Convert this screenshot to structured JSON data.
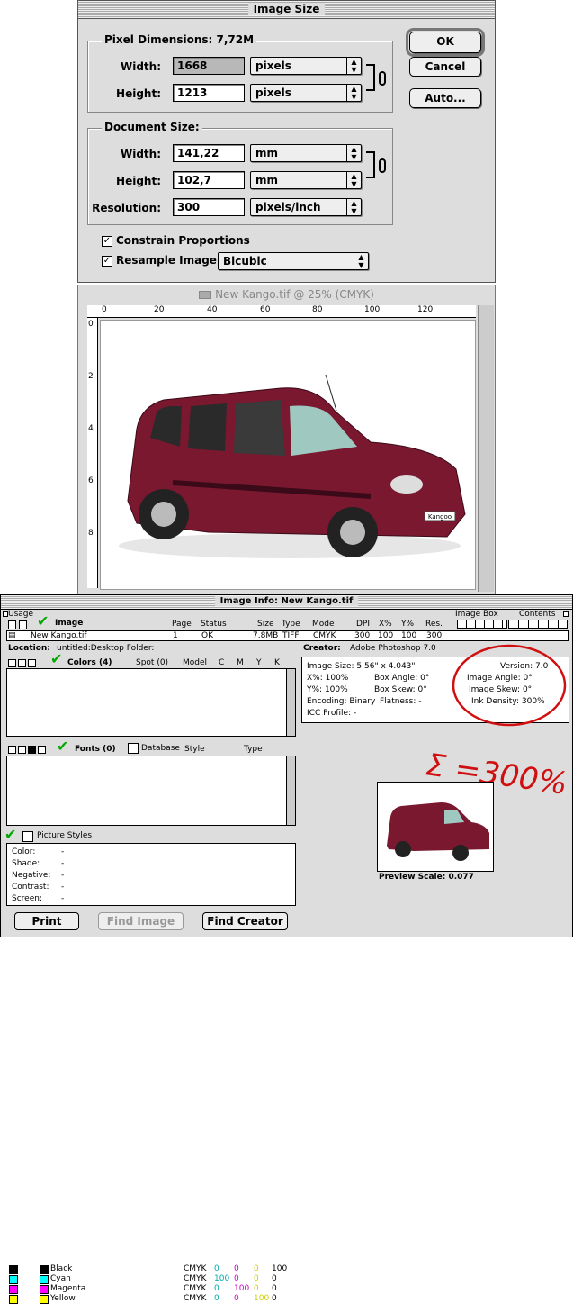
{
  "dialog": {
    "title": "Image Size",
    "pixel_dimensions_label": "Pixel Dimensions: 7,72M",
    "width_label": "Width:",
    "width_value": "1668",
    "width_unit": "pixels",
    "height_label": "Height:",
    "height_value": "1213",
    "height_unit": "pixels",
    "document_size_label": "Document Size:",
    "doc_width_label": "Width:",
    "doc_width_value": "141,22",
    "doc_width_unit": "mm",
    "doc_height_label": "Height:",
    "doc_height_value": "102,7",
    "doc_height_unit": "mm",
    "resolution_label": "Resolution:",
    "resolution_value": "300",
    "resolution_unit": "pixels/inch",
    "constrain_label": "Constrain Proportions",
    "resample_label": "Resample Image:",
    "resample_value": "Bicubic",
    "ok_label": "OK",
    "cancel_label": "Cancel",
    "auto_label": "Auto..."
  },
  "document": {
    "title": "New Kango.tif @ 25% (CMYK)",
    "ruler_top": [
      "0",
      "20",
      "40",
      "60",
      "80",
      "100",
      "120"
    ],
    "ruler_left": [
      "0",
      "2",
      "4",
      "6",
      "8"
    ],
    "badge_text": "Kangoo"
  },
  "info": {
    "title": "Image Info: New Kango.tif",
    "usage_label": "Usage",
    "image_box_label": "Image Box",
    "contents_label": "Contents",
    "image_header": "Image",
    "headers": [
      "Page",
      "Status",
      "Size",
      "Type",
      "Mode",
      "DPI",
      "X%",
      "Y%",
      "Res."
    ],
    "row": {
      "name": "New Kango.tif",
      "page": "1",
      "status": "OK",
      "size": "7.8MB",
      "type": "TIFF",
      "mode": "CMYK",
      "dpi": "300",
      "x": "100",
      "y": "100",
      "res": "300"
    },
    "location_label": "Location:",
    "location_value": "untitled:Desktop Folder:",
    "creator_label": "Creator:",
    "creator_value": "Adobe Photoshop 7.0",
    "colors_header": "Colors (4)",
    "spot_label": "Spot (0)",
    "model_label": "Model",
    "cmyk_headers": [
      "C",
      "M",
      "Y",
      "K"
    ],
    "colors": [
      {
        "name": "Black",
        "model": "CMYK",
        "c": "0",
        "m": "0",
        "y": "0",
        "k": "100",
        "swatch": "#000000"
      },
      {
        "name": "Cyan",
        "model": "CMYK",
        "c": "100",
        "m": "0",
        "y": "0",
        "k": "0",
        "swatch": "#00ffff"
      },
      {
        "name": "Magenta",
        "model": "CMYK",
        "c": "0",
        "m": "100",
        "y": "0",
        "k": "0",
        "swatch": "#ff00ff"
      },
      {
        "name": "Yellow",
        "model": "CMYK",
        "c": "0",
        "m": "0",
        "y": "100",
        "k": "0",
        "swatch": "#ffff00"
      }
    ],
    "fonts_header": "Fonts (0)",
    "database_label": "Database",
    "style_label": "Style",
    "type_label": "Type",
    "picture_styles_label": "Picture Styles",
    "styles": [
      {
        "label": "Color:",
        "value": "-"
      },
      {
        "label": "Shade:",
        "value": "-"
      },
      {
        "label": "Negative:",
        "value": "-"
      },
      {
        "label": "Contrast:",
        "value": "-"
      },
      {
        "label": "Screen:",
        "value": "-"
      }
    ],
    "details": {
      "image_size": "Image Size:  5.56\" x 4.043\"",
      "version": "Version: 7.0",
      "xpct": "X%:  100%",
      "box_angle": "Box Angle:  0°",
      "image_angle": "Image Angle:  0°",
      "ypct": "Y%:  100%",
      "box_skew": "Box Skew:  0°",
      "image_skew": "Image Skew:  0°",
      "encoding": "Encoding:  Binary",
      "flatness": "Flatness:  -",
      "ink_density": "Ink Density:  300%",
      "icc": "ICC Profile:  -"
    },
    "preview_scale": "Preview Scale: 0.077",
    "print_label": "Print",
    "find_image_label": "Find Image",
    "find_creator_label": "Find Creator",
    "annotation": "Σ =300%",
    "annotation_color": "#d01010"
  }
}
